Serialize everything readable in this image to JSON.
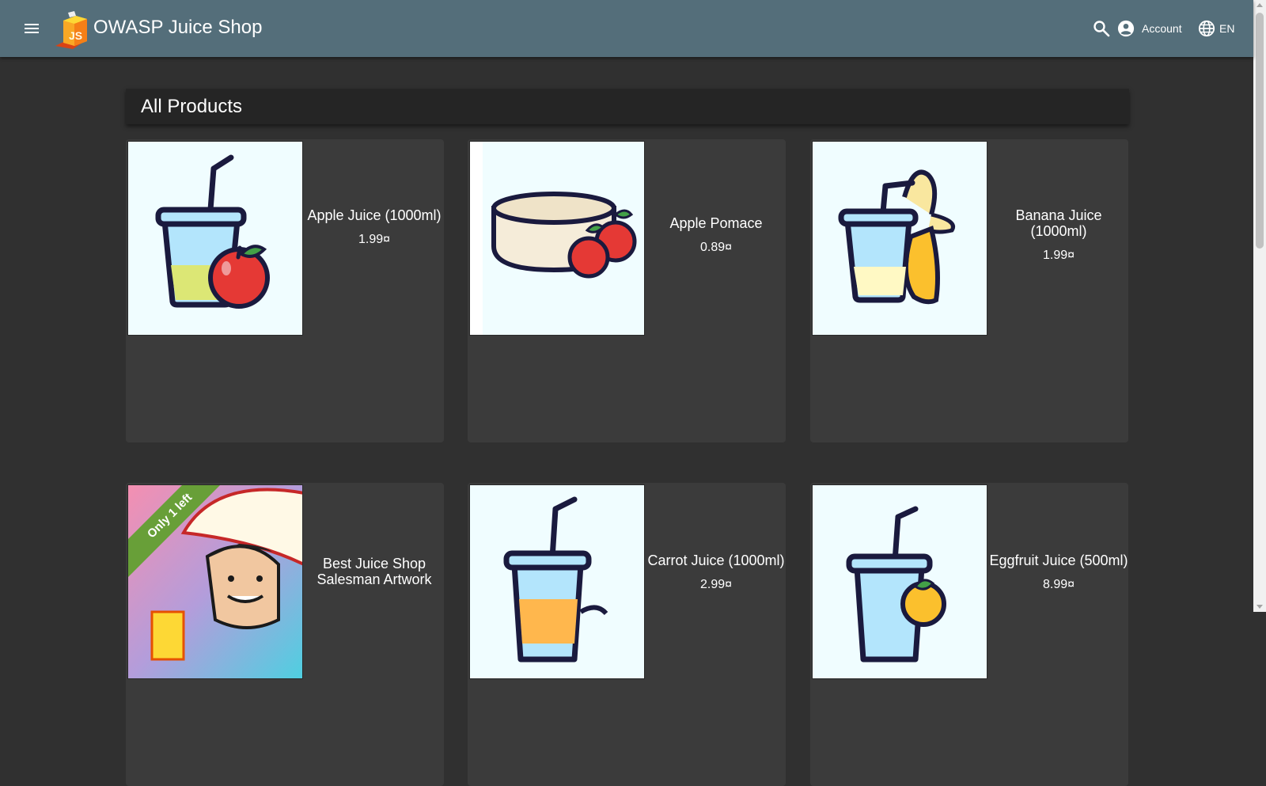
{
  "app": {
    "title": "OWASP Juice Shop"
  },
  "toolbar": {
    "account_label": "Account",
    "language_label": "EN"
  },
  "main": {
    "heading": "All Products"
  },
  "products": [
    {
      "name": "Apple Juice (1000ml)",
      "price": "1.99¤"
    },
    {
      "name": "Apple Pomace",
      "price": "0.89¤"
    },
    {
      "name": "Banana Juice (1000ml)",
      "price": "1.99¤"
    },
    {
      "name": "Best Juice Shop Salesman Artwork",
      "price": "",
      "badge": "Only 1 left"
    },
    {
      "name": "Carrot Juice (1000ml)",
      "price": "2.99¤"
    },
    {
      "name": "Eggfruit Juice (500ml)",
      "price": "8.99¤"
    }
  ],
  "colors": {
    "toolbar": "#546e7a",
    "background": "#303030",
    "card": "#3b3b3b",
    "badge": "#689f38"
  }
}
